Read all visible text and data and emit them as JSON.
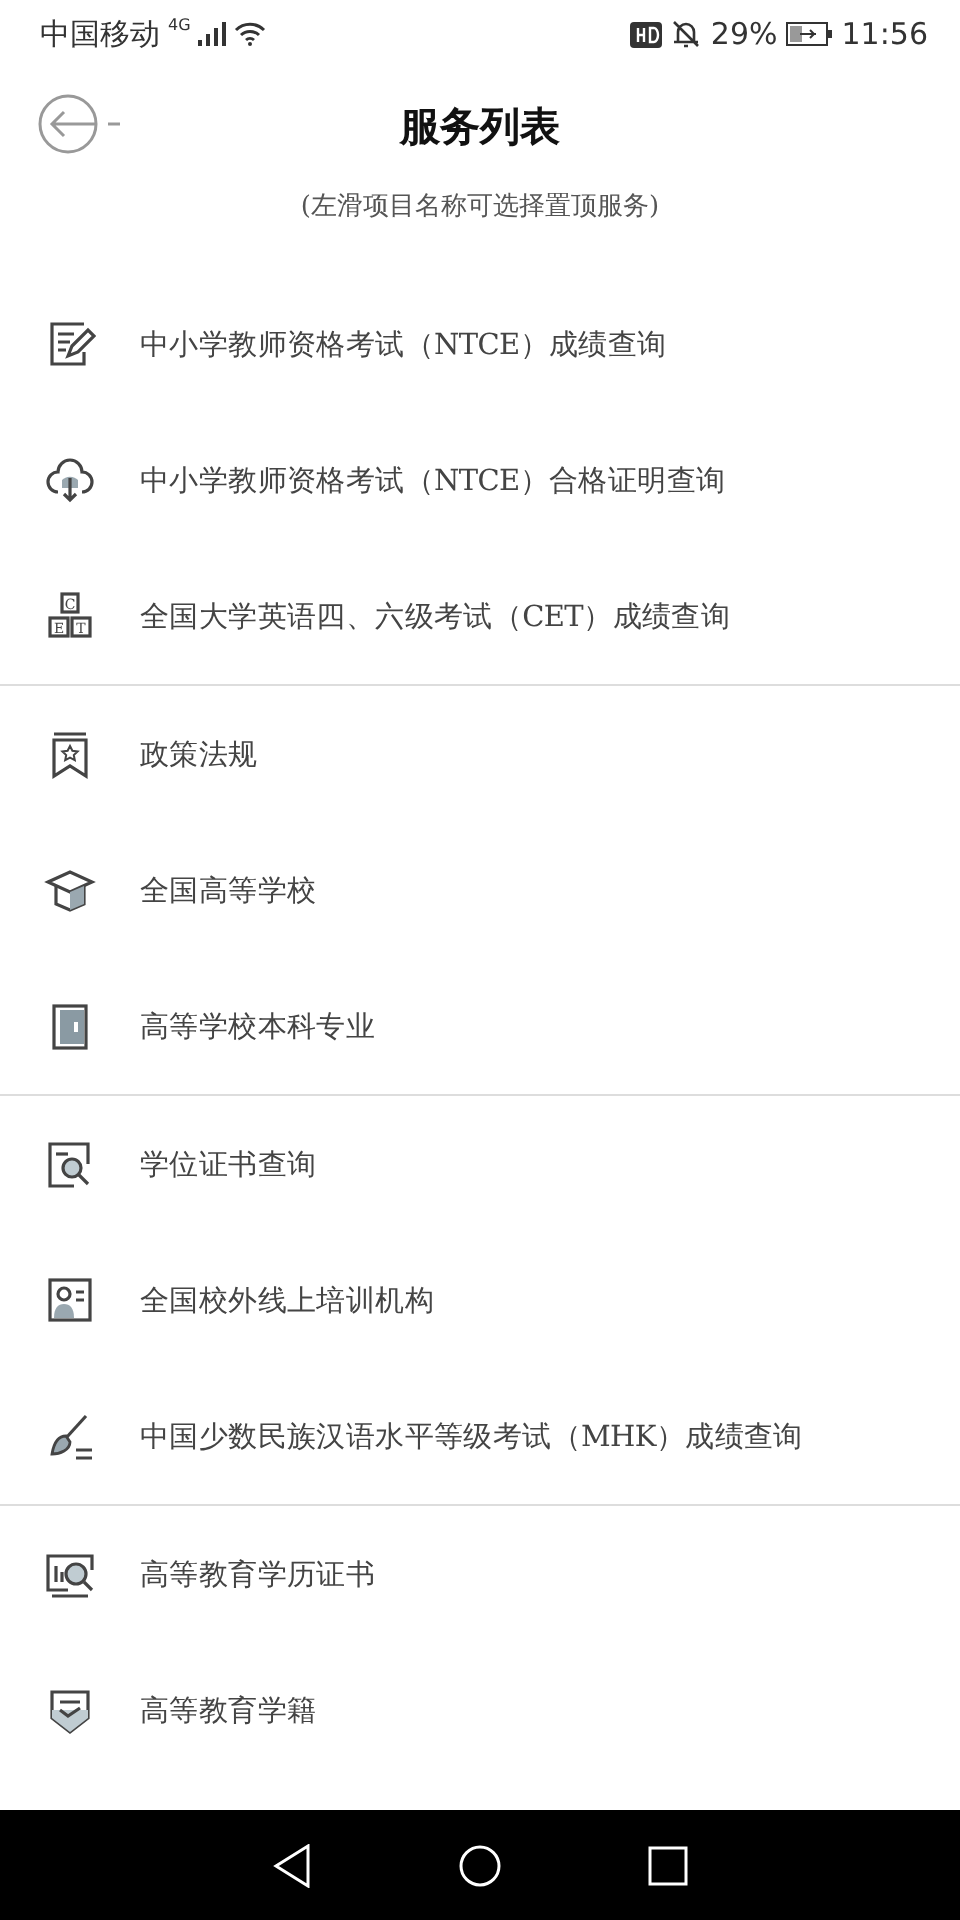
{
  "status_bar": {
    "carrier": "中国移动",
    "network": "4G",
    "battery": "29%",
    "time": "11:56"
  },
  "header": {
    "title": "服务列表",
    "hint": "(左滑项目名称可选择置顶服务)"
  },
  "groups": [
    {
      "items": [
        {
          "kind": "edit",
          "label": "中小学教师资格考试（NTCE）成绩查询"
        },
        {
          "kind": "cloud",
          "label": "中小学教师资格考试（NTCE）合格证明查询"
        },
        {
          "kind": "cet",
          "letters": [
            "C",
            "E",
            "T"
          ],
          "label": "全国大学英语四、六级考试（CET）成绩查询"
        }
      ]
    },
    {
      "items": [
        {
          "kind": "bookmark",
          "label": "政策法规"
        },
        {
          "kind": "cap",
          "label": "全国高等学校"
        },
        {
          "kind": "book",
          "label": "高等学校本科专业"
        }
      ]
    },
    {
      "items": [
        {
          "kind": "cert",
          "label": "学位证书查询"
        },
        {
          "kind": "person",
          "label": "全国校外线上培训机构"
        },
        {
          "kind": "brush",
          "label": "中国少数民族汉语水平等级考试（MHK）成绩查询"
        }
      ]
    },
    {
      "items": [
        {
          "kind": "monitor",
          "label": "高等教育学历证书"
        },
        {
          "kind": "shield",
          "label": "高等教育学籍"
        }
      ]
    }
  ]
}
